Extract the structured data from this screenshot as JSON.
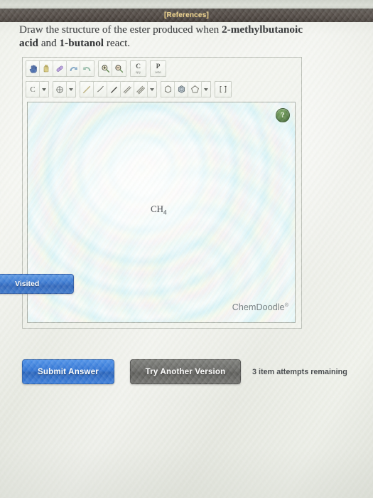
{
  "header": {
    "references_label": "[References]"
  },
  "question": {
    "text_part1": "Draw the structure of the ester produced when ",
    "bold_part1": "2-methylbutanoic acid",
    "text_part2": " and ",
    "bold_part2": "1-butanol",
    "text_part3": " react."
  },
  "editor": {
    "toolbar_row1": [
      {
        "name": "pan-hand-tool",
        "tooltip": "Move / Pan"
      },
      {
        "name": "eraser-bottle-tool",
        "tooltip": "Erase"
      },
      {
        "name": "eraser-tool",
        "tooltip": "Eraser"
      },
      {
        "name": "undo-tool",
        "tooltip": "Undo"
      },
      {
        "name": "redo-tool",
        "tooltip": "Redo"
      },
      {
        "name": "zoom-in-tool",
        "tooltip": "Zoom In"
      },
      {
        "name": "zoom-out-tool",
        "tooltip": "Zoom Out"
      },
      {
        "name": "copy-tool",
        "label": "C",
        "sublabel": "opy"
      },
      {
        "name": "paste-tool",
        "label": "P",
        "sublabel": "aste"
      }
    ],
    "toolbar_row2": [
      {
        "name": "element-carbon-tool",
        "label": "C"
      },
      {
        "name": "element-dropdown",
        "label": "caret"
      },
      {
        "name": "charge-tool",
        "label": "circle-plus"
      },
      {
        "name": "charge-dropdown",
        "label": "caret"
      },
      {
        "name": "single-bond-tool"
      },
      {
        "name": "hash-bond-tool"
      },
      {
        "name": "wedge-bond-tool"
      },
      {
        "name": "double-bond-tool"
      },
      {
        "name": "triple-bond-tool"
      },
      {
        "name": "bond-dropdown",
        "label": "caret"
      },
      {
        "name": "cyclohexane-ring-tool"
      },
      {
        "name": "benzene-ring-tool"
      },
      {
        "name": "cyclopentane-ring-tool"
      },
      {
        "name": "ring-dropdown",
        "label": "caret"
      },
      {
        "name": "bracket-tool"
      }
    ],
    "canvas": {
      "atom_label_text": "CH",
      "atom_label_sub": "4",
      "help_glyph": "?",
      "watermark": "ChemDoodle",
      "watermark_sup": "®"
    }
  },
  "sidebar": {
    "visited_tab_label": "Visited"
  },
  "actions": {
    "submit_label": "Submit Answer",
    "try_another_label": "Try Another Version",
    "attempts_text": "3 item attempts remaining"
  },
  "colors": {
    "accent_blue": "#1d66cf",
    "gray_button": "#595956",
    "references_gold": "#e8c46a",
    "help_green": "#4f7c3a",
    "bar_dark": "#241814"
  }
}
